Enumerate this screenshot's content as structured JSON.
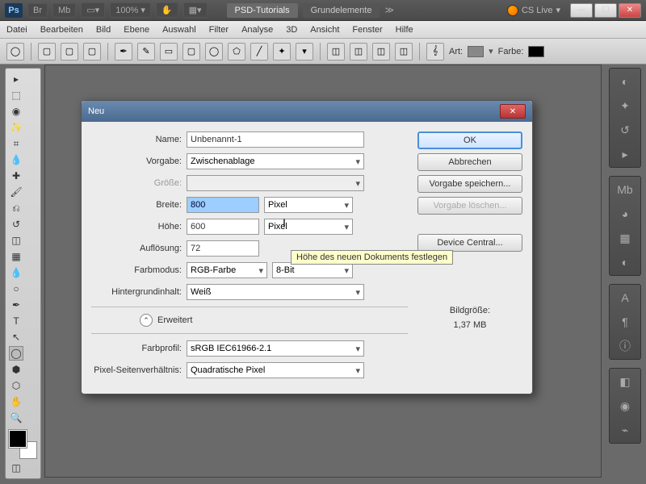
{
  "topbar": {
    "zoom": "100%",
    "tabs": [
      "PSD-Tutorials",
      "Grundelemente"
    ],
    "cslive": "CS Live"
  },
  "menu": [
    "Datei",
    "Bearbeiten",
    "Bild",
    "Ebene",
    "Auswahl",
    "Filter",
    "Analyse",
    "3D",
    "Ansicht",
    "Fenster",
    "Hilfe"
  ],
  "optbar": {
    "art": "Art:",
    "farbe": "Farbe:"
  },
  "dialog": {
    "title": "Neu",
    "name_label": "Name:",
    "name": "Unbenannt-1",
    "preset_label": "Vorgabe:",
    "preset": "Zwischenablage",
    "size_label": "Größe:",
    "width_label": "Breite:",
    "width": "800",
    "width_unit": "Pixel",
    "height_label": "Höhe:",
    "height": "600",
    "height_unit": "Pixel",
    "res_label": "Auflösung:",
    "res": "72",
    "colormode_label": "Farbmodus:",
    "colormode": "RGB-Farbe",
    "bits": "8-Bit",
    "bg_label": "Hintergrundinhalt:",
    "bg": "Weiß",
    "advanced": "Erweitert",
    "profile_label": "Farbprofil:",
    "profile": "sRGB IEC61966-2.1",
    "aspect_label": "Pixel-Seitenverhältnis:",
    "aspect": "Quadratische Pixel",
    "ok": "OK",
    "cancel": "Abbrechen",
    "savepreset": "Vorgabe speichern...",
    "delpreset": "Vorgabe löschen...",
    "devcentral": "Device Central...",
    "filesize_label": "Bildgröße:",
    "filesize": "1,37 MB",
    "tooltip": "Höhe des neuen Dokuments festlegen"
  }
}
